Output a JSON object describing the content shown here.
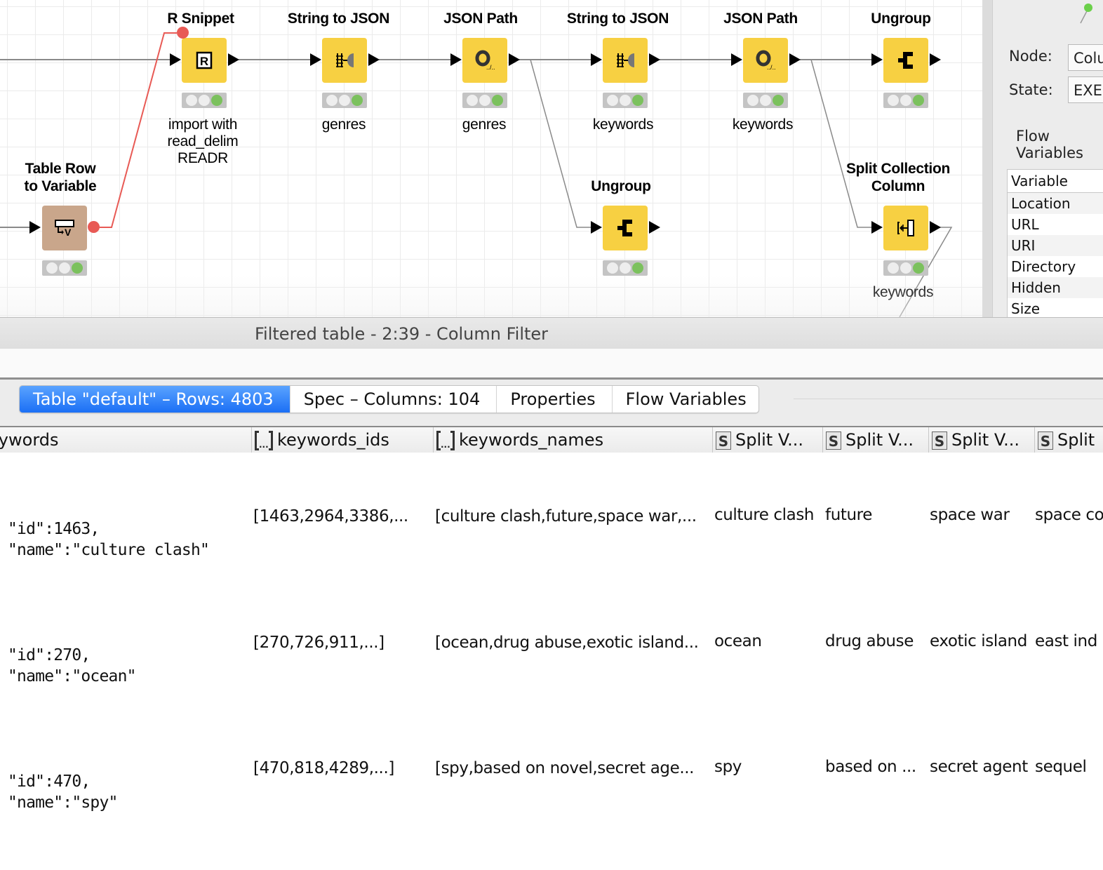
{
  "workflow": {
    "nodes": [
      {
        "id": "r-snippet",
        "title": "R Snippet",
        "label": "import with\nread_delim\nREADR",
        "icon": "r-script-icon"
      },
      {
        "id": "string-to-json-1",
        "title": "String to JSON",
        "label": "genres",
        "icon": "string-to-json-icon"
      },
      {
        "id": "json-path-1",
        "title": "JSON Path",
        "label": "genres",
        "icon": "json-path-icon"
      },
      {
        "id": "string-to-json-2",
        "title": "String to JSON",
        "label": "keywords",
        "icon": "string-to-json-icon"
      },
      {
        "id": "json-path-2",
        "title": "JSON Path",
        "label": "keywords",
        "icon": "json-path-icon"
      },
      {
        "id": "ungroup-1",
        "title": "Ungroup",
        "label": "",
        "icon": "ungroup-icon"
      },
      {
        "id": "table-row-to-variable",
        "title": "Table Row\nto Variable",
        "label": "",
        "icon": "table-row-to-variable-icon"
      },
      {
        "id": "ungroup-2",
        "title": "Ungroup",
        "label": "",
        "icon": "ungroup-icon"
      },
      {
        "id": "split-collection-column",
        "title": "Split Collection\nColumn",
        "label": "keywords",
        "icon": "split-collection-icon"
      }
    ],
    "status": "executed"
  },
  "right_panel": {
    "node_label": "Node:",
    "node_value": "Column Filter",
    "state_label": "State:",
    "state_value": "EXECUTED",
    "section_title": "Flow Variables",
    "table_header": "Variable",
    "variables": [
      "Location",
      "URL",
      "URI",
      "Directory",
      "Hidden",
      "Size"
    ]
  },
  "output": {
    "title": "Filtered table - 2:39 - Column Filter",
    "tabs": [
      {
        "label": "Table \"default\" – Rows: 4803",
        "active": true
      },
      {
        "label": "Spec – Columns: 104",
        "active": false
      },
      {
        "label": "Properties",
        "active": false
      },
      {
        "label": "Flow Variables",
        "active": false
      }
    ],
    "columns": [
      {
        "name": "keywords",
        "type": "json"
      },
      {
        "name": "keywords_ids",
        "type": "list"
      },
      {
        "name": "keywords_names",
        "type": "list"
      },
      {
        "name": "Split V...",
        "type": "string"
      },
      {
        "name": "Split V...",
        "type": "string"
      },
      {
        "name": "Split V...",
        "type": "string"
      },
      {
        "name": "Split",
        "type": "string"
      }
    ],
    "rows": [
      {
        "json": "\"id\":1463,\n\"name\":\"culture clash\"",
        "ids": "[1463,2964,3386,...",
        "names": "[culture clash,future,space war,...",
        "s1": "culture clash",
        "s2": "future",
        "s3": "space war",
        "s4": "space co"
      },
      {
        "json": "\"id\":270,\n\"name\":\"ocean\"",
        "ids": "[270,726,911,...]",
        "names": "[ocean,drug abuse,exotic island...",
        "s1": "ocean",
        "s2": "drug abuse",
        "s3": "exotic island",
        "s4": "east ind"
      },
      {
        "json": "\"id\":470,\n\"name\":\"spy\"",
        "ids": "[470,818,4289,...]",
        "names": "[spy,based on novel,secret age...",
        "s1": "spy",
        "s2": "based on ...",
        "s3": "secret agent",
        "s4": "sequel"
      }
    ]
  }
}
